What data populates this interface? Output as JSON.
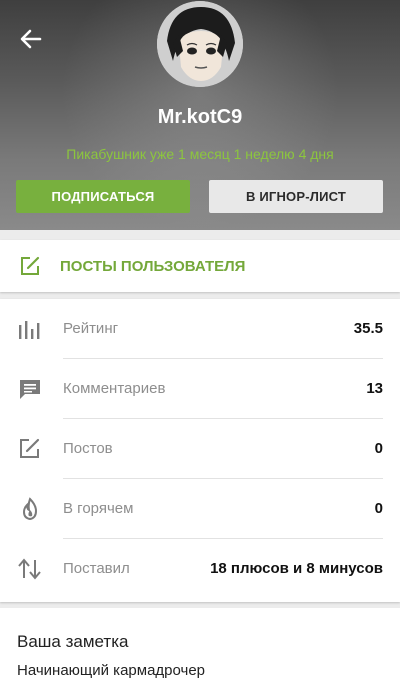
{
  "profile": {
    "username": "Mr.kotC9",
    "tenure": "Пикабушник уже 1 месяц 1 неделю 4 дня",
    "subscribe_label": "ПОДПИСАТЬСЯ",
    "ignore_label": "В ИГНОР-ЛИСТ"
  },
  "posts_link": {
    "label": "ПОСТЫ ПОЛЬЗОВАТЕЛЯ"
  },
  "stats": [
    {
      "label": "Рейтинг",
      "value": "35.5",
      "icon": "rating-bars-icon"
    },
    {
      "label": "Комментариев",
      "value": "13",
      "icon": "comment-icon"
    },
    {
      "label": "Постов",
      "value": "0",
      "icon": "edit-post-icon"
    },
    {
      "label": "В горячем",
      "value": "0",
      "icon": "fire-icon"
    },
    {
      "label": "Поставил",
      "value": "18 плюсов и 8 минусов",
      "icon": "sort-arrows-icon"
    }
  ],
  "note": {
    "title": "Ваша заметка",
    "text": "Начинающий кармадрочер"
  },
  "colors": {
    "accent_green": "#78b03e",
    "tenure_green": "#8cc63e"
  }
}
